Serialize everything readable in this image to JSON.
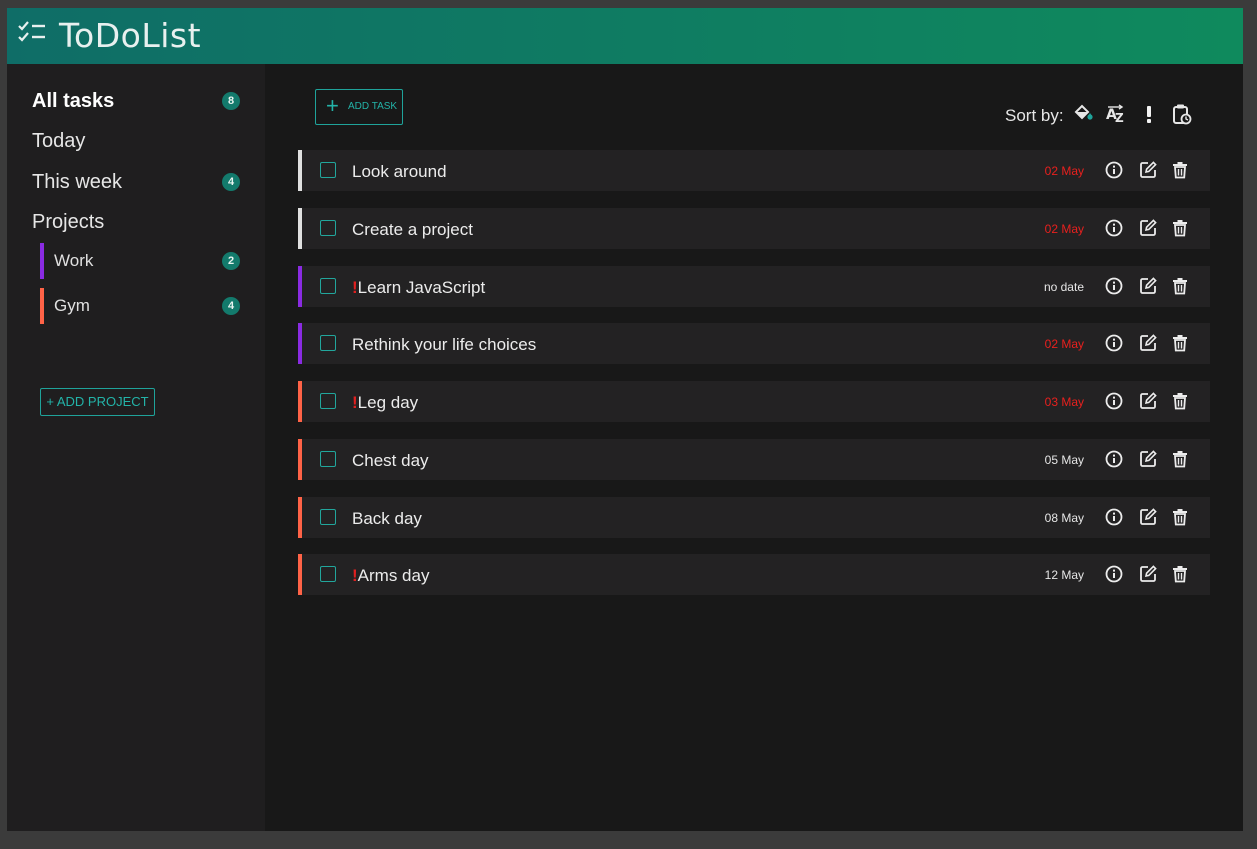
{
  "header": {
    "title": "ToDoList",
    "icon": "checklist-icon"
  },
  "sidebar": {
    "nav": [
      {
        "label": "All tasks",
        "count": "8",
        "active": true
      },
      {
        "label": "Today",
        "count": ""
      },
      {
        "label": "This week",
        "count": "4"
      }
    ],
    "projects_heading": "Projects",
    "projects": [
      {
        "label": "Work",
        "count": "2",
        "color": "#8a2be2"
      },
      {
        "label": "Gym",
        "count": "4",
        "color": "#ff6347"
      }
    ],
    "add_project_label": "+ ADD PROJECT"
  },
  "toolbar": {
    "add_task_label": "ADD TASK",
    "sort_label": "Sort by:",
    "sort_options": [
      "project-color-icon",
      "alphabetical-icon",
      "priority-icon",
      "due-date-icon"
    ]
  },
  "colors": {
    "accent": "#1fa39a",
    "overdue": "#e8201e",
    "priority": "#e02020",
    "no_project": "#e0e0e0"
  },
  "tasks": [
    {
      "title": "Look around",
      "priority": false,
      "date": "02 May",
      "overdue": true,
      "color": "#e0e0e0"
    },
    {
      "title": "Create a project",
      "priority": false,
      "date": "02 May",
      "overdue": true,
      "color": "#e0e0e0"
    },
    {
      "title": "Learn JavaScript",
      "priority": true,
      "date": "no date",
      "overdue": false,
      "color": "#8a2be2"
    },
    {
      "title": "Rethink your life choices",
      "priority": false,
      "date": "02 May",
      "overdue": true,
      "color": "#8a2be2"
    },
    {
      "title": "Leg day",
      "priority": true,
      "date": "03 May",
      "overdue": true,
      "color": "#ff6347"
    },
    {
      "title": "Chest day",
      "priority": false,
      "date": "05 May",
      "overdue": false,
      "color": "#ff6347"
    },
    {
      "title": "Back day",
      "priority": false,
      "date": "08 May",
      "overdue": false,
      "color": "#ff6347"
    },
    {
      "title": "Arms day",
      "priority": true,
      "date": "12 May",
      "overdue": false,
      "color": "#ff6347"
    }
  ],
  "priority_marker": "!"
}
